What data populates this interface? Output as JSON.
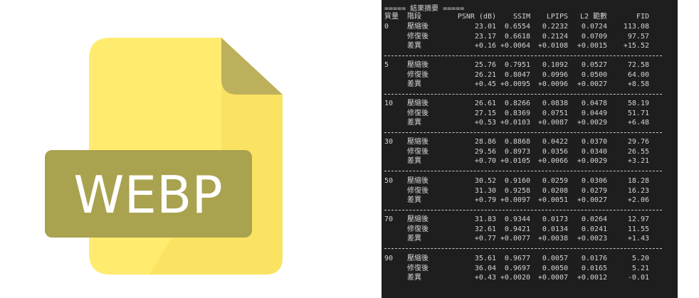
{
  "logo": {
    "label": "WEBP",
    "colors": {
      "page": "#FFEB6E",
      "page_shadow": "#F5DC5A",
      "fold": "#BDB05C",
      "badge": "#A9A24F",
      "badge_text": "#FFFFFF"
    }
  },
  "terminal": {
    "header": "===== 結果摘要 =====",
    "columns": {
      "quality": "質量",
      "stage": "階段",
      "psnr": "PSNR (dB)",
      "ssim": "SSIM",
      "lpips": "LPIPS",
      "l2": "L2 範數",
      "fid": "FID"
    },
    "groups": [
      {
        "quality": "0",
        "rows": [
          {
            "stage": "壓縮後",
            "psnr": "23.01",
            "ssim": "0.6554",
            "lpips": "0.2232",
            "l2": "0.0724",
            "fid": "113.08"
          },
          {
            "stage": "修復後",
            "psnr": "23.17",
            "ssim": "0.6618",
            "lpips": "0.2124",
            "l2": "0.0709",
            "fid": "97.57"
          },
          {
            "stage": "差異",
            "psnr": "+0.16",
            "ssim": "+0.0064",
            "lpips": "+0.0108",
            "l2": "+0.0015",
            "fid": "+15.52"
          }
        ]
      },
      {
        "quality": "5",
        "rows": [
          {
            "stage": "壓縮後",
            "psnr": "25.76",
            "ssim": "0.7951",
            "lpips": "0.1092",
            "l2": "0.0527",
            "fid": "72.58"
          },
          {
            "stage": "修復後",
            "psnr": "26.21",
            "ssim": "0.8047",
            "lpips": "0.0996",
            "l2": "0.0500",
            "fid": "64.00"
          },
          {
            "stage": "差異",
            "psnr": "+0.45",
            "ssim": "+0.0095",
            "lpips": "+0.0096",
            "l2": "+0.0027",
            "fid": "+8.58"
          }
        ]
      },
      {
        "quality": "10",
        "rows": [
          {
            "stage": "壓縮後",
            "psnr": "26.61",
            "ssim": "0.8266",
            "lpips": "0.0838",
            "l2": "0.0478",
            "fid": "58.19"
          },
          {
            "stage": "修復後",
            "psnr": "27.15",
            "ssim": "0.8369",
            "lpips": "0.0751",
            "l2": "0.0449",
            "fid": "51.71"
          },
          {
            "stage": "差異",
            "psnr": "+0.53",
            "ssim": "+0.0103",
            "lpips": "+0.0087",
            "l2": "+0.0029",
            "fid": "+6.48"
          }
        ]
      },
      {
        "quality": "30",
        "rows": [
          {
            "stage": "壓縮後",
            "psnr": "28.86",
            "ssim": "0.8868",
            "lpips": "0.0422",
            "l2": "0.0370",
            "fid": "29.76"
          },
          {
            "stage": "修復後",
            "psnr": "29.56",
            "ssim": "0.8973",
            "lpips": "0.0356",
            "l2": "0.0340",
            "fid": "26.55"
          },
          {
            "stage": "差異",
            "psnr": "+0.70",
            "ssim": "+0.0105",
            "lpips": "+0.0066",
            "l2": "+0.0029",
            "fid": "+3.21"
          }
        ]
      },
      {
        "quality": "50",
        "rows": [
          {
            "stage": "壓縮後",
            "psnr": "30.52",
            "ssim": "0.9160",
            "lpips": "0.0259",
            "l2": "0.0306",
            "fid": "18.28"
          },
          {
            "stage": "修復後",
            "psnr": "31.30",
            "ssim": "0.9258",
            "lpips": "0.0208",
            "l2": "0.0279",
            "fid": "16.23"
          },
          {
            "stage": "差異",
            "psnr": "+0.79",
            "ssim": "+0.0097",
            "lpips": "+0.0051",
            "l2": "+0.0027",
            "fid": "+2.06"
          }
        ]
      },
      {
        "quality": "70",
        "rows": [
          {
            "stage": "壓縮後",
            "psnr": "31.83",
            "ssim": "0.9344",
            "lpips": "0.0173",
            "l2": "0.0264",
            "fid": "12.97"
          },
          {
            "stage": "修復後",
            "psnr": "32.61",
            "ssim": "0.9421",
            "lpips": "0.0134",
            "l2": "0.0241",
            "fid": "11.55"
          },
          {
            "stage": "差異",
            "psnr": "+0.77",
            "ssim": "+0.0077",
            "lpips": "+0.0038",
            "l2": "+0.0023",
            "fid": "+1.43"
          }
        ]
      },
      {
        "quality": "90",
        "rows": [
          {
            "stage": "壓縮後",
            "psnr": "35.61",
            "ssim": "0.9677",
            "lpips": "0.0057",
            "l2": "0.0176",
            "fid": "5.20"
          },
          {
            "stage": "修復後",
            "psnr": "36.04",
            "ssim": "0.9697",
            "lpips": "0.0050",
            "l2": "0.0165",
            "fid": "5.21"
          },
          {
            "stage": "差異",
            "psnr": "+0.43",
            "ssim": "+0.0020",
            "lpips": "+0.0007",
            "l2": "+0.0012",
            "fid": "-0.01"
          }
        ]
      }
    ],
    "footer": "",
    "colors": {
      "background": "#1E1E1E",
      "text": "#D4D4D4",
      "separator": "#C8C8C8"
    }
  }
}
